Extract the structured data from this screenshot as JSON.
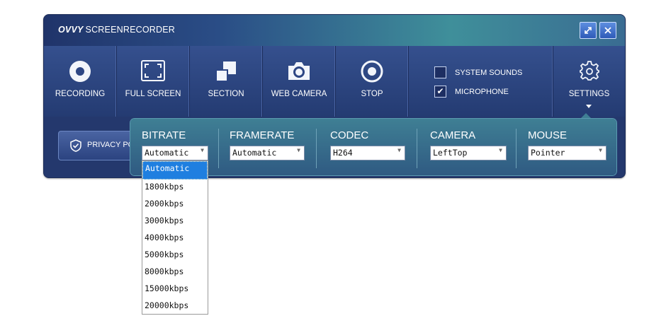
{
  "title": {
    "brand": "OVVY",
    "product": "SCREENRECORDER"
  },
  "toolbar": [
    {
      "label": "RECORDING",
      "icon": "record-icon"
    },
    {
      "label": "FULL SCREEN",
      "icon": "fullscreen-icon"
    },
    {
      "label": "SECTION",
      "icon": "section-icon"
    },
    {
      "label": "WEB CAMERA",
      "icon": "camera-icon"
    },
    {
      "label": "STOP",
      "icon": "stop-icon"
    }
  ],
  "checks": {
    "system_sounds": {
      "label": "SYSTEM SOUNDS",
      "checked": false
    },
    "microphone": {
      "label": "MICROPHONE",
      "checked": true,
      "mark": "✔"
    }
  },
  "settings": {
    "label": "SETTINGS",
    "icon": "gear-icon"
  },
  "privacy": {
    "label": "PRIVACY POL"
  },
  "panel": {
    "bitrate": {
      "label": "BITRATE",
      "value": "Automatic"
    },
    "framerate": {
      "label": "FRAMERATE",
      "value": "Automatic"
    },
    "codec": {
      "label": "CODEC",
      "value": "H264"
    },
    "camera": {
      "label": "CAMERA",
      "value": "LeftTop"
    },
    "mouse": {
      "label": "MOUSE",
      "value": "Pointer"
    }
  },
  "bitrate_options": [
    "Automatic",
    "1800kbps",
    "2000kbps",
    "3000kbps",
    "4000kbps",
    "5000kbps",
    "8000kbps",
    "15000kbps",
    "20000kbps"
  ],
  "bitrate_selected": "Automatic",
  "colors": {
    "accent": "#1f7fe0",
    "toolbar": "#2a3f78",
    "panel": "#3f7f94"
  }
}
